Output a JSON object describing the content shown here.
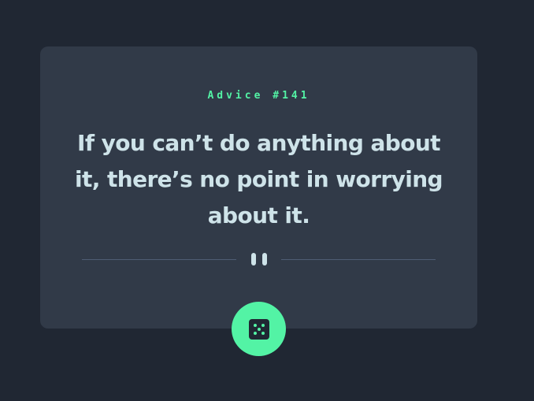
{
  "advice": {
    "id_label": "Advice #141",
    "quote": "If you can’t do anything about it, there’s no point in worrying about it."
  },
  "icons": {
    "divider": "pause-icon",
    "button": "dice-icon"
  },
  "colors": {
    "background": "#202733",
    "card": "#313a48",
    "accent": "#53f3a5",
    "text": "#cee3e9",
    "divider": "#4f5d74"
  }
}
